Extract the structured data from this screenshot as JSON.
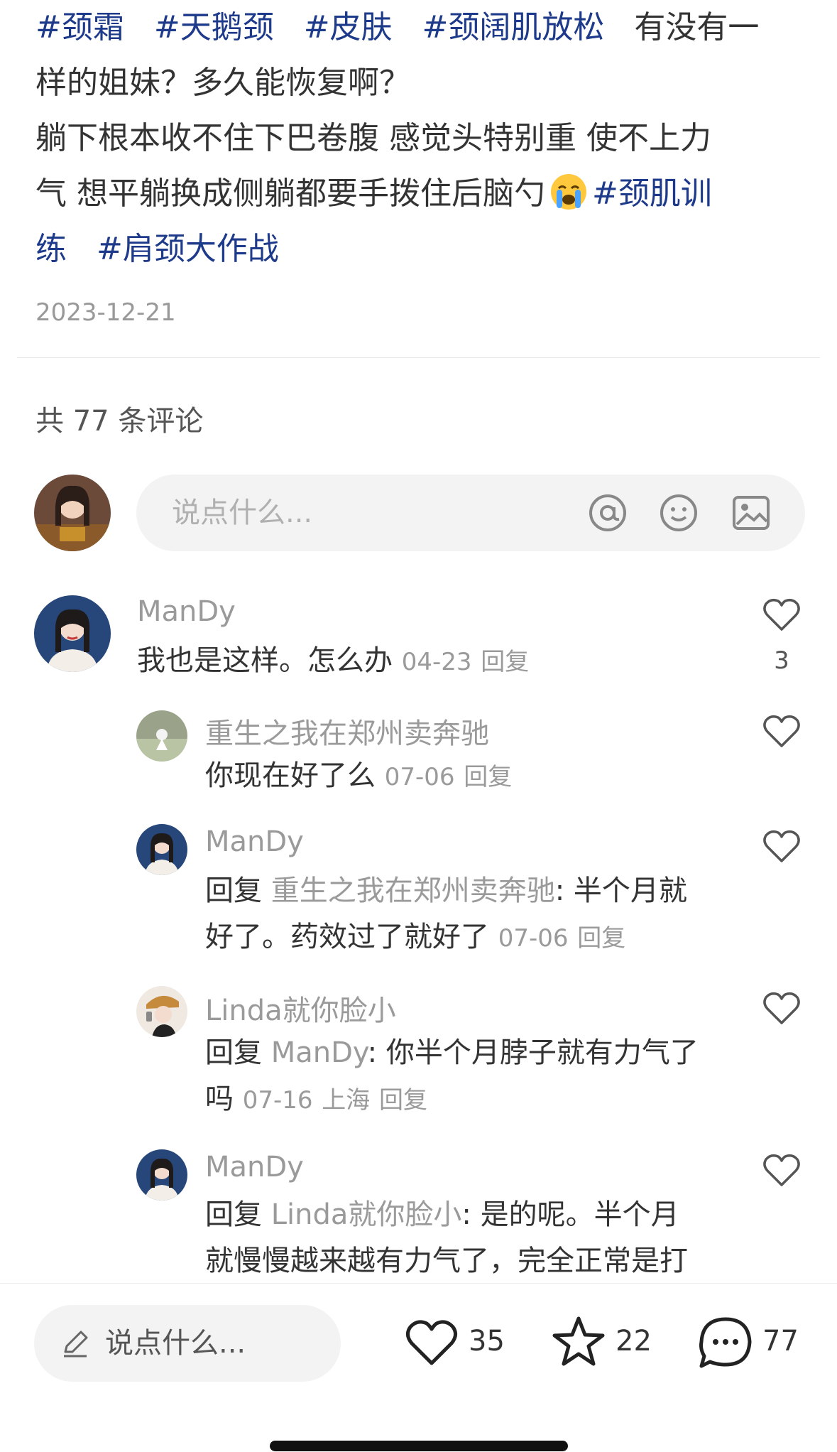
{
  "post": {
    "tags_line1": [
      "#颈霜",
      "#天鹅颈",
      "#皮肤",
      "#颈阔肌放松"
    ],
    "text_line1_tail": "有没有一",
    "text_line2": "样的姐妹？多久能恢复啊？",
    "text_line3": "躺下根本收不住下巴卷腹 感觉头特别重 使不上力",
    "text_line4_a": "气 想平躺换成侧躺都要手拨住后脑勺",
    "tag_line4": "#颈肌训",
    "tag_line5_a": "练",
    "tag_line5_b": "#肩颈大作战",
    "date": "2023-12-21",
    "emoji_name": "crying-face-emoji"
  },
  "comments_header": "共 77 条评论",
  "comment_input": {
    "placeholder": "说点什么...",
    "icons": [
      "at-icon",
      "emoji-icon",
      "image-icon"
    ]
  },
  "comments": [
    {
      "name": "ManDy",
      "text": "我也是这样。怎么办",
      "date": "04-23",
      "reply": "回复",
      "likes": "3"
    },
    {
      "name": "重生之我在郑州卖奔驰",
      "text": "你现在好了么",
      "date": "07-06",
      "reply": "回复"
    },
    {
      "name": "ManDy",
      "prefix": "回复",
      "ref": "重生之我在郑州卖奔驰",
      "text1": ": 半个月就",
      "text2": "好了。药效过了就好了",
      "date": "07-06",
      "reply": "回复"
    },
    {
      "name": "Linda就你脸小",
      "prefix": "回复",
      "ref": "ManDy",
      "text1": ": 你半个月脖子就有力气了",
      "text2": "吗",
      "date": "07-16",
      "location": "上海",
      "reply": "回复"
    },
    {
      "name": "ManDy",
      "prefix": "回复",
      "ref": "Linda就你脸小",
      "text1": ": 是的呢。半个月",
      "text2": "就慢慢越来越有力气了，完全正常是打"
    }
  ],
  "bottom_bar": {
    "placeholder": "说点什么...",
    "likes": "35",
    "favorites": "22",
    "comments": "77"
  },
  "colors": {
    "tag": "#1e3a8a",
    "muted": "#9a9a9a",
    "text": "#333333",
    "pill": "#f3f3f3"
  }
}
